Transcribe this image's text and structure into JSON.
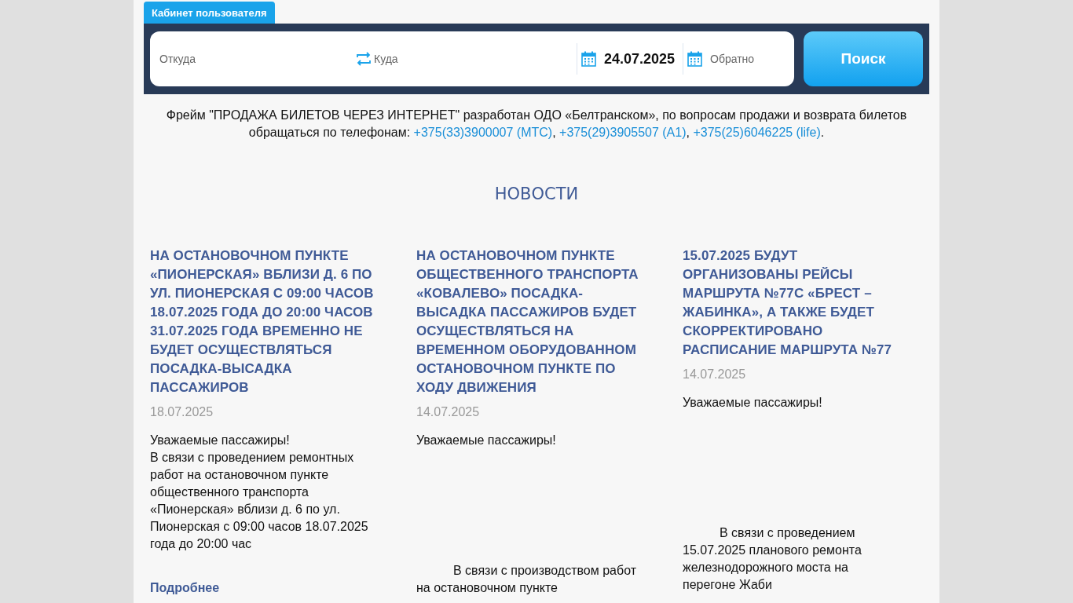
{
  "cabinet_tab": {
    "label": "Кабинет пользователя"
  },
  "search": {
    "from_placeholder": "Откуда",
    "to_placeholder": "Куда",
    "date": "24.07.2025",
    "return_placeholder": "Обратно",
    "button": "Поиск"
  },
  "notice": {
    "text": "Фрейм \"ПРОДАЖА БИЛЕТОВ ЧЕРЕЗ ИНТЕРНЕТ\" разработан ОДО «Белтранском», по вопросам продажи и возврата билетов обращаться по телефонам:",
    "phones": [
      {
        "number": "+375(33)3900007 (МТС)",
        "punct": ","
      },
      {
        "number": "+375(29)3905507 (А1)",
        "punct": ","
      },
      {
        "number": "+375(25)6046225 (life)",
        "punct": "."
      }
    ]
  },
  "news": {
    "heading": "НОВОСТИ",
    "items": [
      {
        "title": "НА ОСТАНОВОЧНОМ ПУНКТЕ «ПИОНЕРСКАЯ» ВБЛИЗИ Д. 6 ПО УЛ. ПИОНЕРСКАЯ С 09:00 ЧАСОВ 18.07.2025 ГОДА ДО 20:00 ЧАСОВ 31.07.2025 ГОДА ВРЕМЕННО НЕ БУДЕТ ОСУЩЕСТВЛЯТЬСЯ ПОСАДКА-ВЫСАДКА ПАССАЖИРОВ",
        "date": "18.07.2025",
        "paragraphs": [
          {
            "text": "Уважаемые пассажиры!",
            "indented": false
          },
          {
            "text": "В связи с проведением ремонтных работ на остановочном пункте общественного транспорта «Пионерская» вблизи д. 6 по ул. Пионерская с 09:00 часов 18.07.2025 года до 20:00 час",
            "indented": false
          }
        ],
        "more": "Подробнее"
      },
      {
        "title": "НА ОСТАНОВОЧНОМ ПУНКТЕ ОБЩЕСТВЕННОГО ТРАНСПОРТА «КОВАЛЕВО» ПОСАДКА-ВЫСАДКА ПАССАЖИРОВ БУДЕТ ОСУЩЕСТВЛЯТЬСЯ НА ВРЕМЕННОМ ОБОРУДОВАННОМ ОСТАНОВОЧНОМ ПУНКТЕ ПО ХОДУ ДВИЖЕНИЯ",
        "date": "14.07.2025",
        "paragraphs": [
          {
            "text": "Уважаемые пассажиры!",
            "indented": false
          },
          {
            "text": "В связи с производством работ на остановочном пункте",
            "indented": true
          }
        ]
      },
      {
        "title": "15.07.2025 БУДУТ ОРГАНИЗОВАНЫ РЕЙСЫ МАРШРУТА №77С «БРЕСТ – ЖАБИНКА», А ТАКЖЕ БУДЕТ СКОРРЕКТИРОВАНО РАСПИСАНИЕ МАРШРУТА №77",
        "date": "14.07.2025",
        "paragraphs": [
          {
            "text": "Уважаемые пассажиры!",
            "indented": false
          },
          {
            "text": "В связи с проведением 15.07.2025 планового ремонта железнодорожного моста на перегоне Жаби",
            "indented": true
          }
        ]
      }
    ]
  }
}
